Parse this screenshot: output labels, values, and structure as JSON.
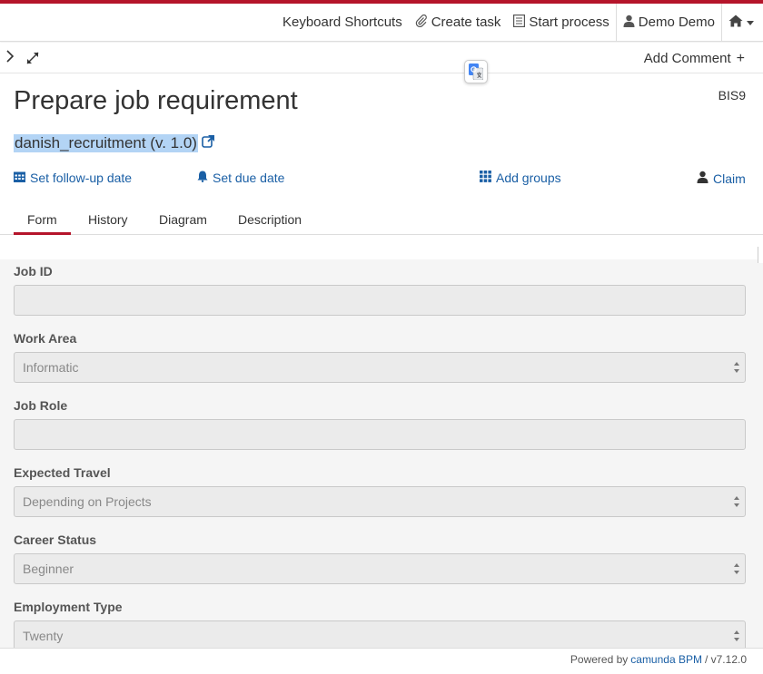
{
  "topnav": {
    "keyboard_shortcuts": "Keyboard Shortcuts",
    "create_task": "Create task",
    "start_process": "Start process",
    "user": "Demo Demo"
  },
  "toolbar": {
    "add_comment": "Add Comment",
    "add_comment_plus": "+"
  },
  "task": {
    "title": "Prepare job requirement",
    "key": "BIS9",
    "process_definition": "danish_recruitment (v. 1.0)"
  },
  "actions": {
    "follow_up": "Set follow-up date",
    "due_date": "Set due date",
    "add_groups": "Add groups",
    "claim": "Claim"
  },
  "tabs": [
    {
      "label": "Form",
      "active": true
    },
    {
      "label": "History",
      "active": false
    },
    {
      "label": "Diagram",
      "active": false
    },
    {
      "label": "Description",
      "active": false
    }
  ],
  "form": {
    "fields": [
      {
        "label": "Job ID",
        "type": "text",
        "value": ""
      },
      {
        "label": "Work Area",
        "type": "select",
        "value": "Informatic"
      },
      {
        "label": "Job Role",
        "type": "text",
        "value": ""
      },
      {
        "label": "Expected Travel",
        "type": "select",
        "value": "Depending on Projects"
      },
      {
        "label": "Career Status",
        "type": "select",
        "value": "Beginner"
      },
      {
        "label": "Employment Type",
        "type": "select",
        "value": "Twenty"
      }
    ]
  },
  "footer": {
    "powered_by": "Powered by",
    "brand": "camunda BPM",
    "version": "/ v7.12.0"
  },
  "colors": {
    "accent_red": "#b5152b",
    "link_blue": "#1a5fa5",
    "highlight": "#b3d4f5"
  }
}
